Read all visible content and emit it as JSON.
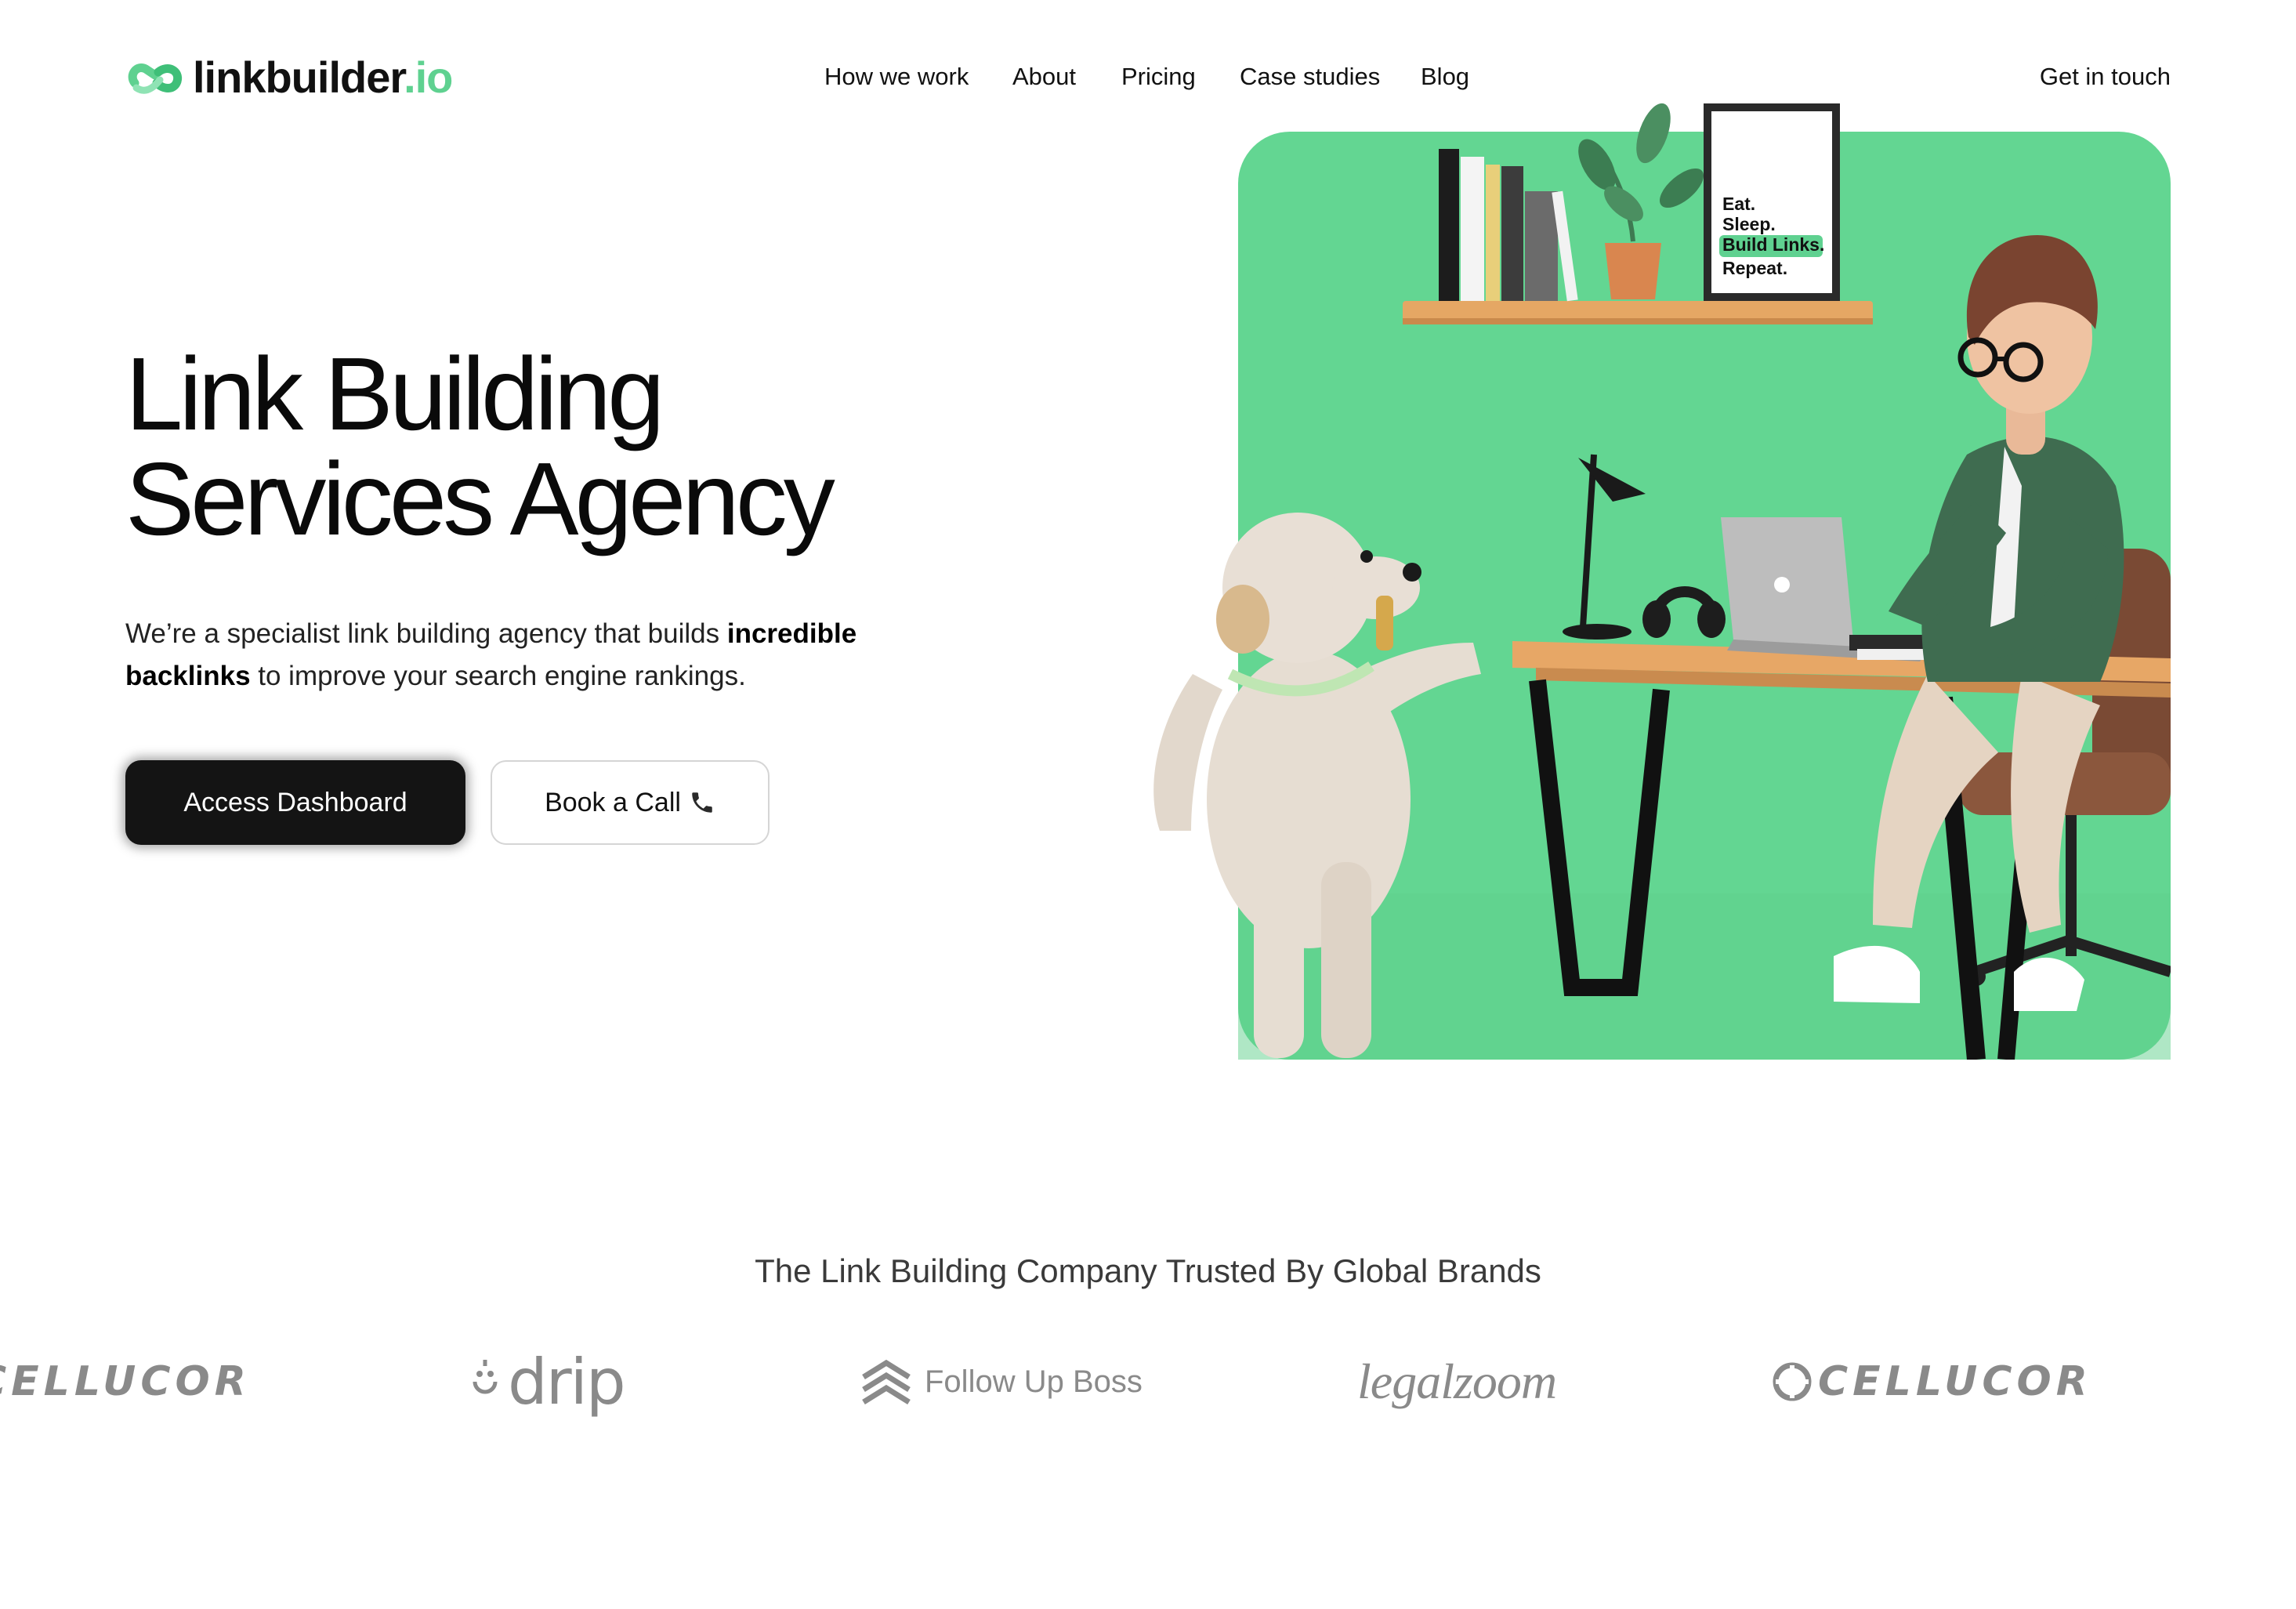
{
  "header": {
    "logo": {
      "name": "linkbuilder",
      "tld": ".io"
    },
    "nav": [
      "How we work",
      "About",
      "Pricing",
      "Case studies",
      "Blog"
    ],
    "contact_link": "Get in touch"
  },
  "hero": {
    "title_line1": "Link Building",
    "title_line2": "Services Agency",
    "description_pre": "We’re a specialist link building agency that builds ",
    "description_bold": "incredible backlinks",
    "description_post": " to improve your search engine rankings.",
    "primary_button": "Access Dashboard",
    "secondary_button": "Book a Call",
    "poster": [
      "Eat.",
      "Sleep.",
      "Build Links.",
      "Repeat."
    ]
  },
  "brands": {
    "title": "The Link Building Company Trusted By Global Brands",
    "logos": [
      "CELLUCOR",
      "drip",
      "Follow Up Boss",
      "legalzoom",
      "CELLUCOR"
    ]
  },
  "colors": {
    "accent_green": "#5fd190",
    "hero_bg_green": "#63d692",
    "primary_button": "#141414",
    "brand_grey": "#8a8a8a"
  }
}
